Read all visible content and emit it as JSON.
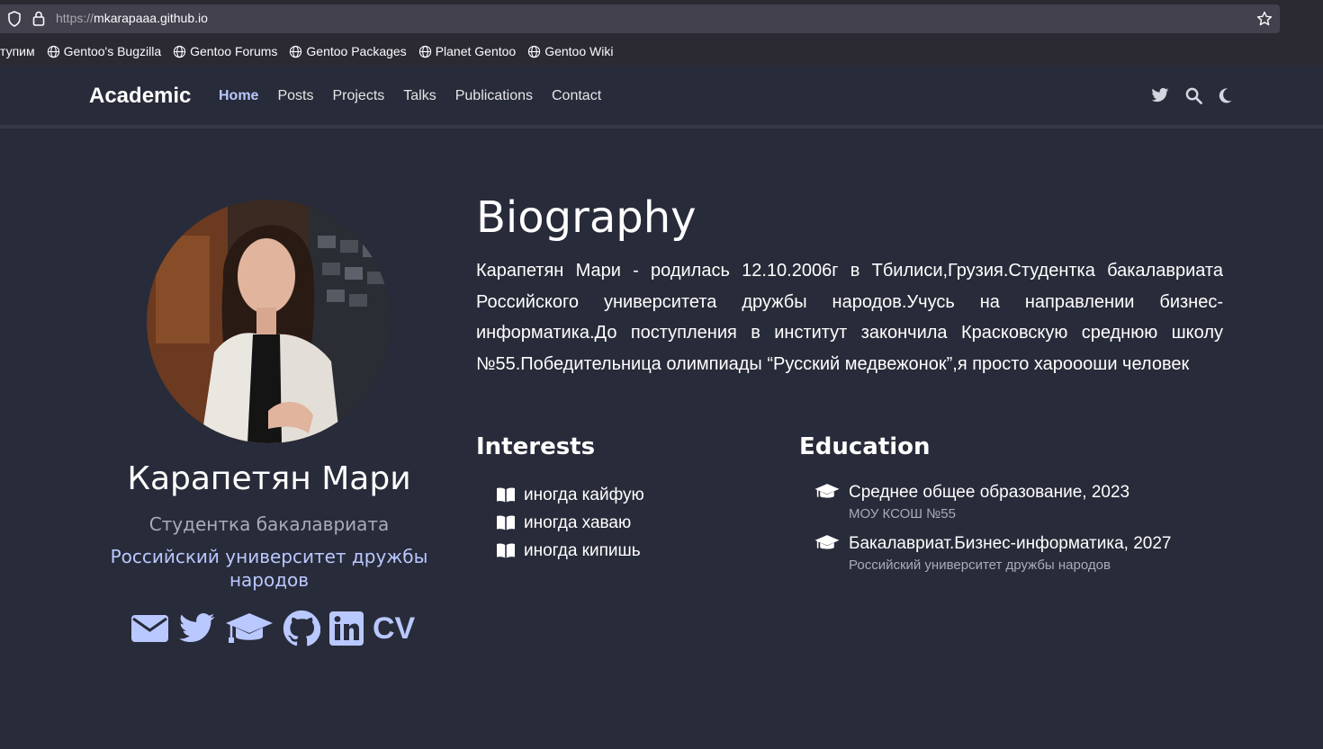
{
  "browser": {
    "url_proto": "https://",
    "url_host": "mkarapaaa.github.io",
    "bookmarks": [
      "тупим",
      "Gentoo's Bugzilla",
      "Gentoo Forums",
      "Gentoo Packages",
      "Planet Gentoo",
      "Gentoo Wiki"
    ]
  },
  "navbar": {
    "brand": "Academic",
    "links": [
      "Home",
      "Posts",
      "Projects",
      "Talks",
      "Publications",
      "Contact"
    ],
    "active": "Home",
    "icons": [
      "twitter-icon",
      "search-icon",
      "moon-icon"
    ]
  },
  "profile": {
    "name": "Карапетян Мари",
    "role": "Студентка бакалавриата",
    "organization": "Российский университет дружбы народов",
    "social_icons": [
      "envelope-icon",
      "twitter-icon",
      "graduation-cap-icon",
      "github-icon",
      "linkedin-icon"
    ],
    "cv_label": "CV"
  },
  "biography": {
    "title": "Biography",
    "text": "Карапетян Мари - родилась 12.10.2006г в Тбилиси,Грузия.Студентка бакалавриата Российского университета дружбы народов.Учусь на направлении бизнес-информатика.До поступления в институт закончила Красковскую среднюю школу №55.Победительница олимпиады “Русский медвежонок”,я просто харoooши человек"
  },
  "interests": {
    "title": "Interests",
    "items": [
      "иногда кайфую",
      "иногда хаваю",
      "иногда кипишь"
    ]
  },
  "education": {
    "title": "Education",
    "items": [
      {
        "course": "Среднее общее образование, 2023",
        "institution": "МОУ КСОШ №55"
      },
      {
        "course": "Бакалавриат.Бизнес-информатика, 2027",
        "institution": "Российский университет дружбы народов"
      }
    ]
  },
  "colors": {
    "background": "#282b39",
    "accent": "#b9c8ff",
    "muted": "#a8abb8"
  }
}
